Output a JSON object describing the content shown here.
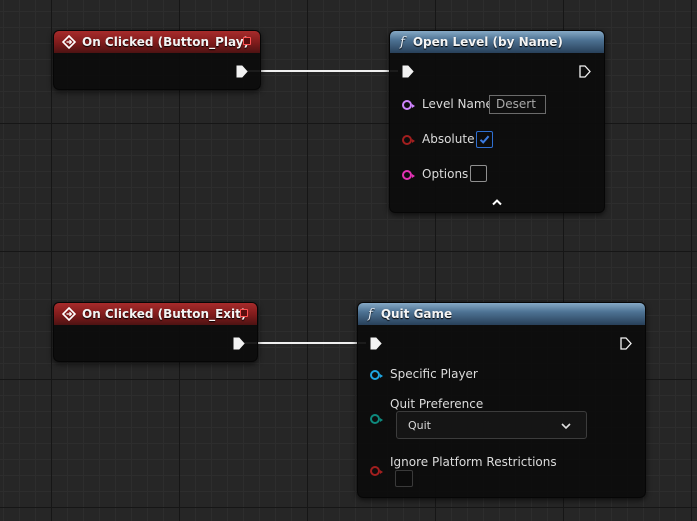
{
  "nodes": {
    "play_event": {
      "title": "On Clicked (Button_Play)"
    },
    "open_level": {
      "title": "Open Level (by Name)",
      "func_symbol": "f",
      "pins": {
        "level_name_label": "Level Name",
        "level_name_value": "Desert",
        "absolute_label": "Absolute",
        "absolute_checked": true,
        "options_label": "Options",
        "options_checked": false
      }
    },
    "exit_event": {
      "title": "On Clicked (Button_Exit)"
    },
    "quit_game": {
      "title": "Quit Game",
      "func_symbol": "f",
      "pins": {
        "specific_player_label": "Specific Player",
        "quit_preference_label": "Quit Preference",
        "quit_preference_value": "Quit",
        "ignore_restrictions_label": "Ignore Platform Restrictions",
        "ignore_restrictions_checked": false
      }
    }
  },
  "colors": {
    "event_header": "#8b1f1f",
    "function_header": "#4e7394",
    "delegate_pin": "#ff5252",
    "string_pin": "#cf84ff",
    "bool_pin": "#a21f1f",
    "struct_pin": "#e432b5",
    "object_pin": "#1ea5e0",
    "enum_pin": "#0e8a7e",
    "checkbox_accent": "#2f6fd1"
  }
}
